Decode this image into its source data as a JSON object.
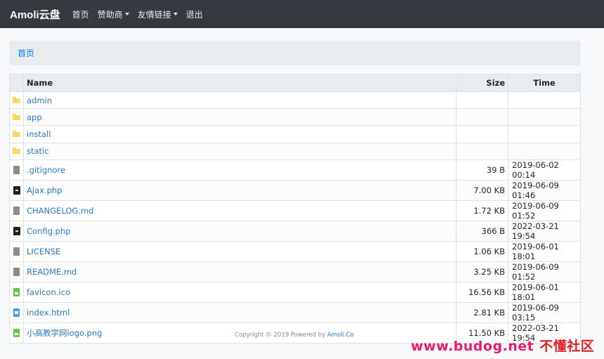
{
  "nav": {
    "brand": "Amoli云盘",
    "items": [
      {
        "label": "首页",
        "dropdown": false
      },
      {
        "label": "赞助商",
        "dropdown": true
      },
      {
        "label": "友情链接",
        "dropdown": true
      },
      {
        "label": "退出",
        "dropdown": false
      }
    ]
  },
  "breadcrumb": {
    "home": "首页"
  },
  "table": {
    "headers": {
      "name": "Name",
      "size": "Size",
      "time": "Time"
    },
    "rows": [
      {
        "icon": "folder-icon",
        "name": "admin",
        "size": "",
        "time": ""
      },
      {
        "icon": "folder-icon",
        "name": "app",
        "size": "",
        "time": ""
      },
      {
        "icon": "folder-icon",
        "name": "install",
        "size": "",
        "time": ""
      },
      {
        "icon": "folder-icon",
        "name": "static",
        "size": "",
        "time": ""
      },
      {
        "icon": "file-icon",
        "name": ".gitignore",
        "size": "39 B",
        "time": "2019-06-02 00:14"
      },
      {
        "icon": "php-file-icon",
        "name": "Ajax.php",
        "size": "7.00 KB",
        "time": "2019-06-09 01:46"
      },
      {
        "icon": "file-icon",
        "name": "CHANGELOG.md",
        "size": "1.72 KB",
        "time": "2019-06-09 01:52"
      },
      {
        "icon": "php-file-icon",
        "name": "Config.php",
        "size": "366 B",
        "time": "2022-03-21 19:54"
      },
      {
        "icon": "file-icon",
        "name": "LICENSE",
        "size": "1.06 KB",
        "time": "2019-06-01 18:01"
      },
      {
        "icon": "file-icon",
        "name": "README.md",
        "size": "3.25 KB",
        "time": "2019-06-09 01:52"
      },
      {
        "icon": "image-file-icon",
        "name": "favicon.ico",
        "size": "16.56 KB",
        "time": "2019-06-01 18:01"
      },
      {
        "icon": "html-file-icon",
        "name": "index.html",
        "size": "2.81 KB",
        "time": "2019-06-09 03:15"
      },
      {
        "icon": "image-file-icon",
        "name": "小高教学网logo.png",
        "size": "11.50 KB",
        "time": "2022-03-21 19:54"
      }
    ]
  },
  "footer": {
    "text": "Copyright © 2019 Powered by ",
    "link": "Amoli.Co"
  },
  "watermark": {
    "url": "www.budog.net",
    "site": "不懂社区"
  },
  "colors": {
    "navbar": "#343a40",
    "link": "#2a7ac6",
    "folder": "#ffd966",
    "watermark": "#e8176f"
  }
}
